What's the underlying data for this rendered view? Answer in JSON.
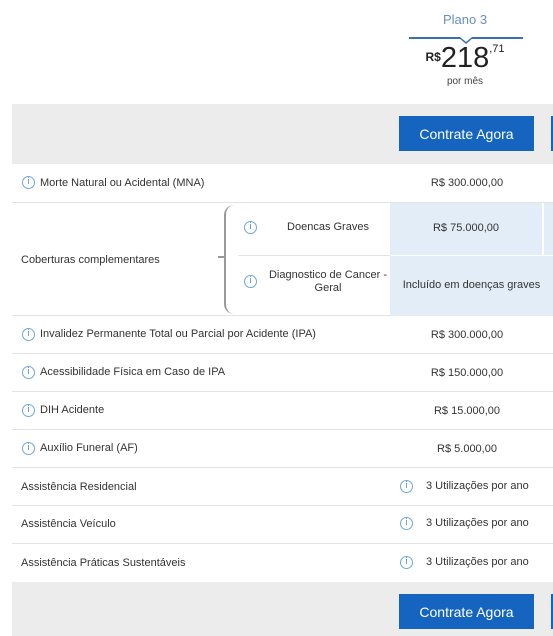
{
  "plan": {
    "name": "Plano 3",
    "currency": "R$",
    "price_int": "218",
    "price_cents": ",71",
    "period": "por mês"
  },
  "cta": {
    "label": "Contrate Agora"
  },
  "coverages": [
    {
      "label": "Morte Natural ou Acidental (MNA)",
      "value": "R$ 300.000,00"
    }
  ],
  "complementary": {
    "label": "Coberturas complementares",
    "items": [
      {
        "label": "Doencas Graves",
        "value": "R$ 75.000,00"
      },
      {
        "label": "Diagnostico de Cancer - Geral",
        "value": "Incluído em doenças graves"
      }
    ]
  },
  "more_coverages": [
    {
      "label": "Invalidez Permanente Total ou Parcial por Acidente (IPA)",
      "value": "R$ 300.000,00"
    },
    {
      "label": "Acessibilidade Física em Caso de IPA",
      "value": "R$ 150.000,00"
    },
    {
      "label": "DIH Acidente",
      "value": "R$ 15.000,00"
    },
    {
      "label": "Auxílio Funeral (AF)",
      "value": "R$ 5.000,00"
    }
  ],
  "assistances": [
    {
      "label": "Assistência Residencial",
      "value": "3 Utilizações por ano"
    },
    {
      "label": "Assistência Veículo",
      "value": "3 Utilizações por ano"
    },
    {
      "label": "Assistência Práticas Sustentáveis",
      "value": "3 Utilizações por ano"
    }
  ],
  "icons": {
    "info": "info-icon"
  },
  "colors": {
    "accent": "#1565c0",
    "info": "#6fa8d8",
    "highlight": "#e3edf7",
    "band": "#ececec"
  }
}
